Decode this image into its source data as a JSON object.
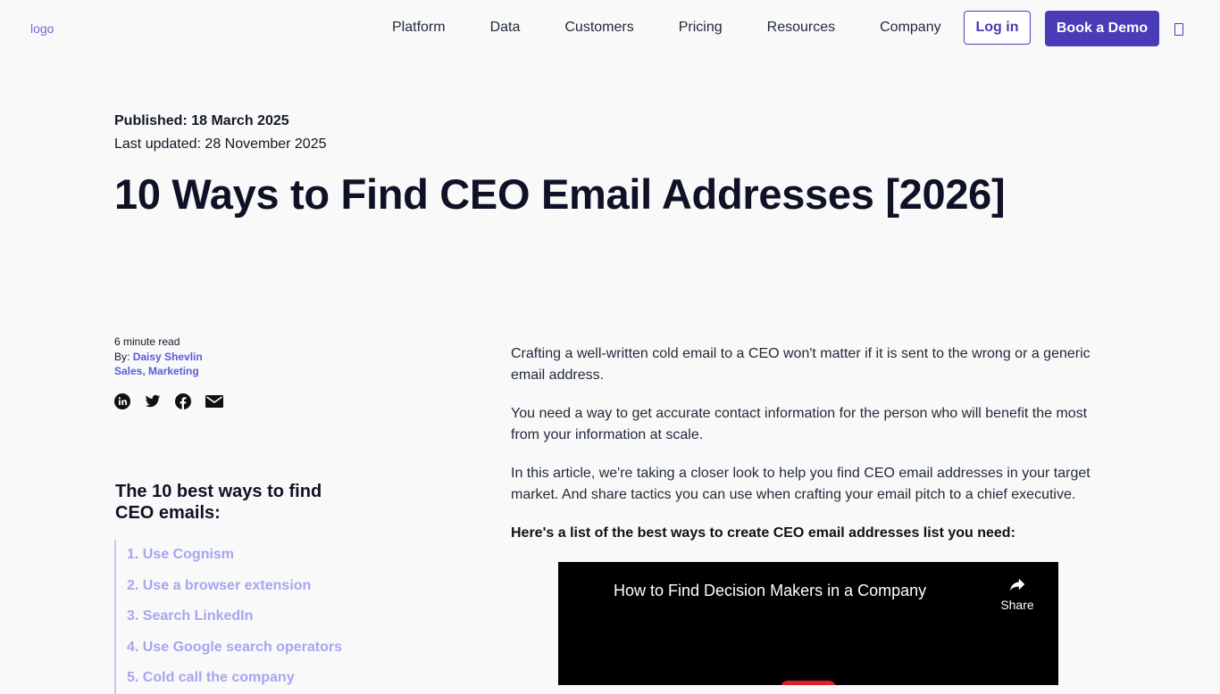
{
  "header": {
    "logo_alt": "logo",
    "nav": [
      "Platform",
      "Data",
      "Customers",
      "Pricing",
      "Resources",
      "Company"
    ],
    "login_label": "Log in",
    "demo_label": "Book a Demo"
  },
  "article": {
    "published": "Published: 18 March 2025",
    "updated": "Last updated: 28 November 2025",
    "title": "10 Ways to Find CEO Email Addresses [2026]",
    "read_time": "6 minute read",
    "by_label": "By:",
    "author": "Daisy Shevlin",
    "categories": "Sales, Marketing",
    "share_icons": [
      "linkedin-icon",
      "twitter-icon",
      "facebook-icon",
      "email-icon"
    ]
  },
  "toc": {
    "title": "The 10 best ways to find CEO emails:",
    "items": [
      "1. Use Cognism",
      "2. Use a browser extension",
      "3. Search LinkedIn",
      "4. Use Google search operators",
      "5. Cold call the company"
    ]
  },
  "body": {
    "paragraphs": [
      "Crafting a well-written cold email to a CEO won't matter if it is sent to the wrong or a generic email address.",
      "You need a way to get accurate contact information for the person who will benefit the most from your information at scale.",
      "In this article, we're taking a closer look to help you find CEO email addresses in your target market. And share tactics you can use when crafting your email pitch to a chief executive."
    ],
    "list_intro": "Here's a list of the best ways to create CEO email addresses list you need:"
  },
  "video": {
    "title": "How to Find Decision Makers in a Company",
    "share_label": "Share"
  },
  "colors": {
    "brand": "#4a3bb7",
    "link": "#5b5bd6",
    "toc_link": "#a5a6ee",
    "background": "#f9f9fa"
  }
}
